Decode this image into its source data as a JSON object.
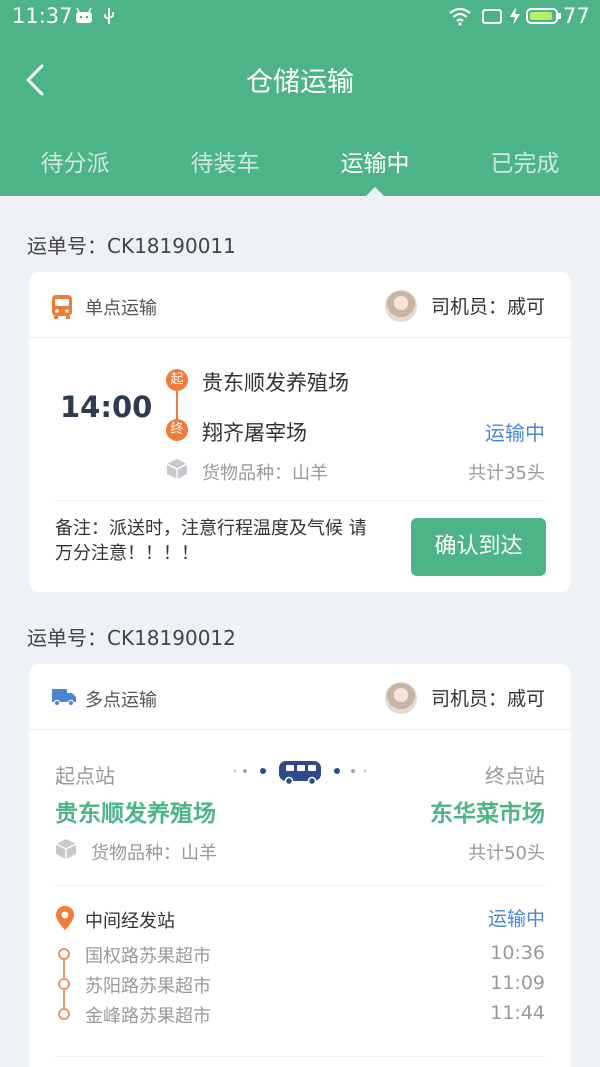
{
  "status_bar": {
    "time": "11:37",
    "battery": "77"
  },
  "header": {
    "title": "仓储运输"
  },
  "tabs": [
    {
      "label": "待分派"
    },
    {
      "label": "待装车"
    },
    {
      "label": "运输中"
    },
    {
      "label": "已完成"
    }
  ],
  "orders": [
    {
      "order_no": "运单号：CK18190011",
      "type_label": "单点运输",
      "driver": "司机员：戚可",
      "time": "14:00",
      "start_badge": "起",
      "end_badge": "终",
      "start": "贵东顺发养殖场",
      "end": "翔齐屠宰场",
      "status": "运输中",
      "goods": "货物品种：山羊",
      "count": "共计35头",
      "note": "备注：派送时，注意行程温度及气候 请万分注意！！！！",
      "confirm_label": "确认到达"
    },
    {
      "order_no": "运单号：CK18190012",
      "type_label": "多点运输",
      "driver": "司机员：戚可",
      "start_label": "起点站",
      "end_label": "终点站",
      "start": "贵东顺发养殖场",
      "end": "东华菜市场",
      "goods": "货物品种：山羊",
      "count": "共计50头",
      "mid_label": "中间经发站",
      "status": "运输中",
      "stops": [
        {
          "name": "国权路苏果超市",
          "time": "10:36"
        },
        {
          "name": "苏阳路苏果超市",
          "time": "11:09"
        },
        {
          "name": "金峰路苏果超市",
          "time": "11:44"
        }
      ]
    }
  ],
  "colors": {
    "primary": "#4cb488",
    "accent_orange": "#f07a3a",
    "status_blue": "#4a86d6"
  }
}
